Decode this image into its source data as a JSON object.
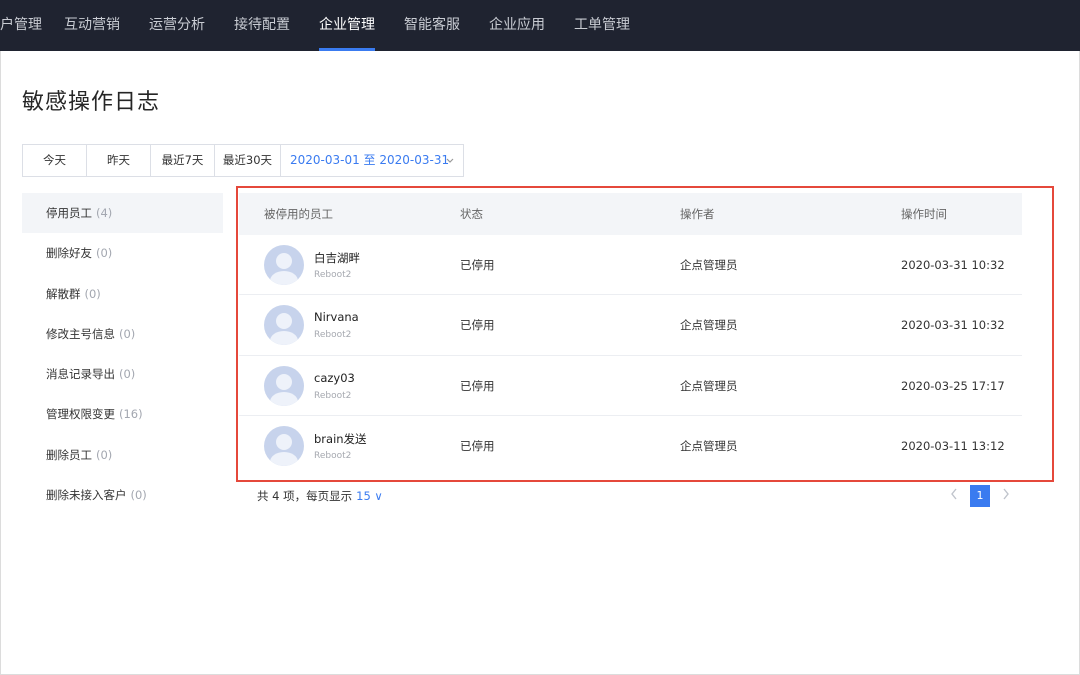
{
  "nav": {
    "items": [
      {
        "label": "户管理",
        "active": false
      },
      {
        "label": "互动营销",
        "active": false
      },
      {
        "label": "运营分析",
        "active": false
      },
      {
        "label": "接待配置",
        "active": false
      },
      {
        "label": "企业管理",
        "active": true
      },
      {
        "label": "智能客服",
        "active": false
      },
      {
        "label": "企业应用",
        "active": false
      },
      {
        "label": "工单管理",
        "active": false
      }
    ]
  },
  "page": {
    "title": "敏感操作日志"
  },
  "range": {
    "buttons": [
      "今天",
      "昨天",
      "最近7天",
      "最近30天"
    ],
    "picker": "2020-03-01 至 2020-03-31",
    "chevron_icon": "chevron-down-icon"
  },
  "sidebar": {
    "items": [
      {
        "label": "停用员工",
        "count": "(4)",
        "active": true
      },
      {
        "label": "删除好友",
        "count": "(0)",
        "active": false
      },
      {
        "label": "解散群",
        "count": "(0)",
        "active": false
      },
      {
        "label": "修改主号信息",
        "count": "(0)",
        "active": false
      },
      {
        "label": "消息记录导出",
        "count": "(0)",
        "active": false
      },
      {
        "label": "管理权限变更",
        "count": "(16)",
        "active": false
      },
      {
        "label": "删除员工",
        "count": "(0)",
        "active": false
      },
      {
        "label": "删除未接入客户",
        "count": "(0)",
        "active": false
      }
    ]
  },
  "table": {
    "headers": [
      "被停用的员工",
      "状态",
      "操作者",
      "操作时间"
    ],
    "rows": [
      {
        "name": "白吉湖畔",
        "sub": "Reboot2",
        "status": "已停用",
        "operator": "企点管理员",
        "time": "2020-03-31 10:32"
      },
      {
        "name": "Nirvana",
        "sub": "Reboot2",
        "status": "已停用",
        "operator": "企点管理员",
        "time": "2020-03-31 10:32"
      },
      {
        "name": "cazy03",
        "sub": "Reboot2",
        "status": "已停用",
        "operator": "企点管理员",
        "time": "2020-03-25 17:17"
      },
      {
        "name": "brain发送",
        "sub": "Reboot2",
        "status": "已停用",
        "operator": "企点管理员",
        "time": "2020-03-11 13:12"
      }
    ]
  },
  "footer": {
    "summary": "共 4 项，每页显示",
    "page_size": "15 ∨",
    "current_page": "1",
    "prev_icon": "chevron-left-icon",
    "next_icon": "chevron-right-icon"
  },
  "colors": {
    "accent": "#3a7bf0",
    "nav_bg": "#1f2330",
    "highlight": "#e5483b"
  }
}
